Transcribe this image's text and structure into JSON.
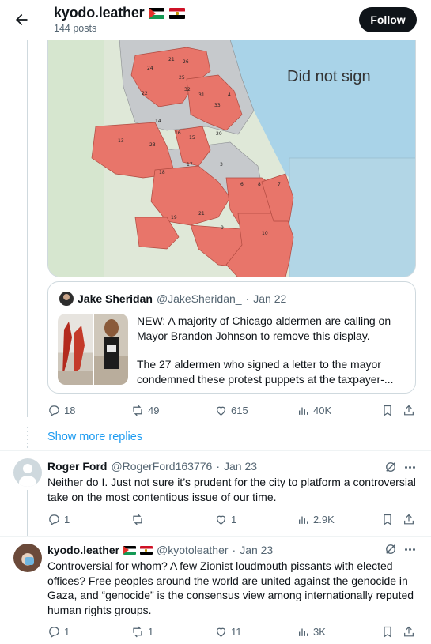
{
  "header": {
    "title": "kyodo.leather",
    "post_count": "144 posts",
    "follow_label": "Follow",
    "flags": [
      "palestine-flag",
      "egypt-flag"
    ]
  },
  "map": {
    "legend_text": "Did not sign",
    "district_labels": [
      "21",
      "24",
      "26",
      "25",
      "22",
      "32",
      "31",
      "4",
      "33",
      "14",
      "20",
      "16",
      "15",
      "13",
      "23",
      "3",
      "17",
      "18",
      "6",
      "8",
      "7",
      "21",
      "19",
      "9",
      "10",
      "27",
      "34",
      "42"
    ],
    "colors": {
      "signed": "#e8756a",
      "not_signed": "#c6c9cc",
      "water": "#a9d3e8"
    }
  },
  "quote": {
    "author_name": "Jake Sheridan",
    "handle": "@JakeSheridan_",
    "separator": "·",
    "date": "Jan 22",
    "paragraph1": "NEW: A majority of Chicago aldermen are calling on Mayor Brandon Johnson to remove this display.",
    "paragraph2": "The 27 aldermen who signed a letter to the mayor condemned these protest puppets at the taxpayer-..."
  },
  "main_actions": {
    "replies": "18",
    "reposts": "49",
    "likes": "615",
    "views": "40K"
  },
  "show_more_label": "Show more replies",
  "replies": [
    {
      "name": "Roger Ford",
      "handle": "@RogerFord163776",
      "separator": "·",
      "date": "Jan 23",
      "text": "Neither do I. Just not sure it’s prudent for the city to platform a controversial take on the most contentious issue of our time.",
      "actions": {
        "replies": "1",
        "reposts": "",
        "likes": "1",
        "views": "2.9K"
      }
    },
    {
      "name": "kyodo.leather",
      "handle": "@kyotoleather",
      "separator": "·",
      "date": "Jan 23",
      "text": "Controversial for whom? A few Zionist loudmouth pissants with elected offices? Free peoples around the world are united against the genocide in Gaza, and “genocide” is the consensus view among internationally reputed human rights groups.",
      "actions": {
        "replies": "1",
        "reposts": "1",
        "likes": "11",
        "views": "3K"
      }
    }
  ]
}
